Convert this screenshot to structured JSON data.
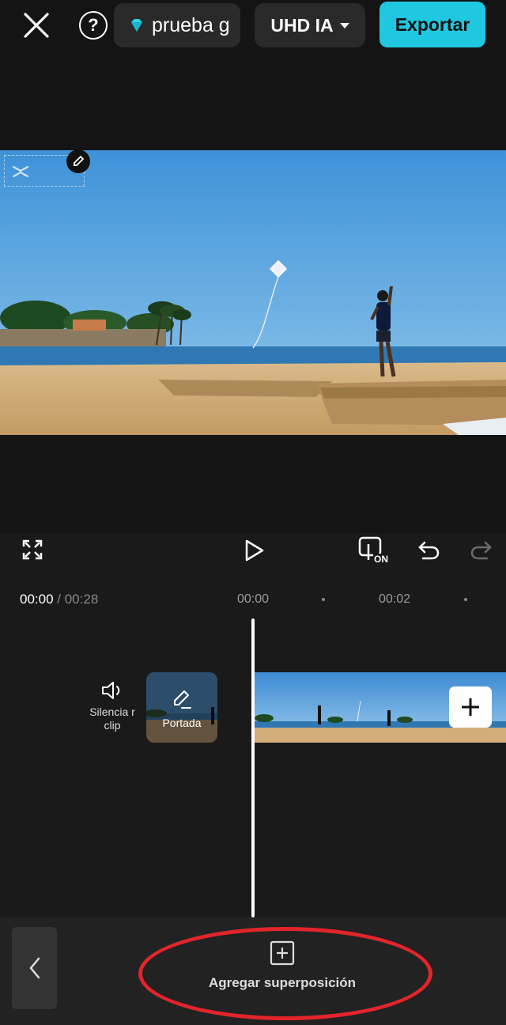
{
  "header": {
    "project_name": "prueba g",
    "quality_label": "UHD IA",
    "export_label": "Exportar",
    "help_symbol": "?"
  },
  "icons": {
    "close": "close-icon",
    "help": "help-icon",
    "gem": "gem-icon",
    "fullscreen": "fullscreen-icon",
    "play": "play-icon",
    "captions": "captions-on-icon",
    "undo": "undo-icon",
    "redo": "redo-icon",
    "mute": "speaker-icon",
    "cover_edit": "pencil-icon",
    "add": "plus-icon",
    "back": "chevron-left-icon",
    "overlay": "add-overlay-icon"
  },
  "controls": {
    "caption_badge": "ON"
  },
  "timeline": {
    "current_time": "00:00",
    "total_time": "/ 00:28",
    "ruler_labels": [
      "00:00",
      "00:02"
    ],
    "mute_label": "Silencia r clip",
    "cover_label": "Portada"
  },
  "bottom": {
    "add_overlay_label": "Agregar superposición"
  },
  "colors": {
    "accent": "#1fc8e0",
    "highlight": "#e2252b",
    "background": "#1a1a1a"
  }
}
